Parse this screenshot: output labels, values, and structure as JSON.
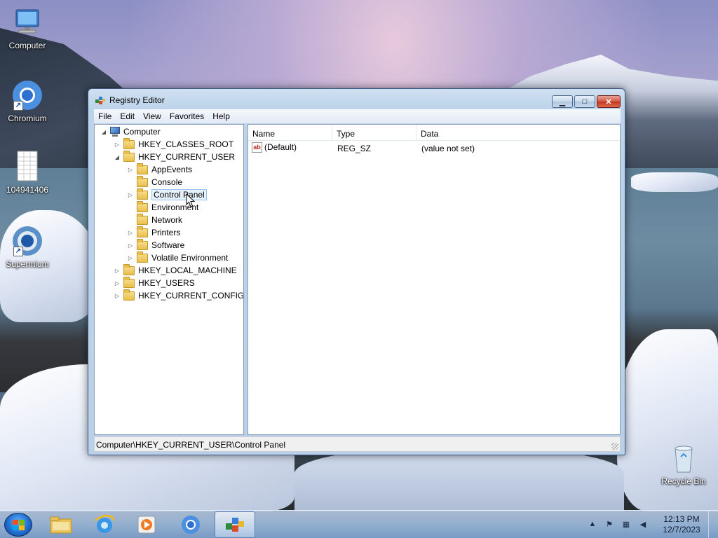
{
  "desktop": {
    "icons": [
      {
        "label": "Computer",
        "icon": "computer-icon"
      },
      {
        "label": "Chromium",
        "icon": "chromium-icon"
      },
      {
        "label": "104941406",
        "icon": "spreadsheet-file-icon"
      },
      {
        "label": "Supermium",
        "icon": "supermium-icon"
      },
      {
        "label": "Recycle Bin",
        "icon": "recycle-bin-icon"
      }
    ]
  },
  "window": {
    "title": "Registry Editor",
    "menu": [
      "File",
      "Edit",
      "View",
      "Favorites",
      "Help"
    ],
    "tree": [
      {
        "label": "Computer",
        "level": 0,
        "expanded": true
      },
      {
        "label": "HKEY_CLASSES_ROOT",
        "level": 1,
        "expanded": false
      },
      {
        "label": "HKEY_CURRENT_USER",
        "level": 1,
        "expanded": true
      },
      {
        "label": "AppEvents",
        "level": 2,
        "expanded": false
      },
      {
        "label": "Console",
        "level": 2,
        "expanded": false
      },
      {
        "label": "Control Panel",
        "level": 2,
        "expanded": false,
        "selected": true
      },
      {
        "label": "Environment",
        "level": 2,
        "expanded": false
      },
      {
        "label": "Network",
        "level": 2,
        "expanded": false
      },
      {
        "label": "Printers",
        "level": 2,
        "expanded": false
      },
      {
        "label": "Software",
        "level": 2,
        "expanded": false
      },
      {
        "label": "Volatile Environment",
        "level": 2,
        "expanded": false
      },
      {
        "label": "HKEY_LOCAL_MACHINE",
        "level": 1,
        "expanded": false
      },
      {
        "label": "HKEY_USERS",
        "level": 1,
        "expanded": false
      },
      {
        "label": "HKEY_CURRENT_CONFIG",
        "level": 1,
        "expanded": false
      }
    ],
    "columns": [
      "Name",
      "Type",
      "Data"
    ],
    "values": [
      {
        "name": "(Default)",
        "type": "REG_SZ",
        "data": "(value not set)"
      }
    ],
    "status": "Computer\\HKEY_CURRENT_USER\\Control Panel"
  },
  "taskbar": {
    "items": [
      "windows-explorer-icon",
      "internet-explorer-icon",
      "media-player-icon",
      "chromium-icon",
      "registry-editor-icon"
    ],
    "active": "registry-editor-icon",
    "time": "12:13 PM",
    "date": "12/7/2023"
  }
}
